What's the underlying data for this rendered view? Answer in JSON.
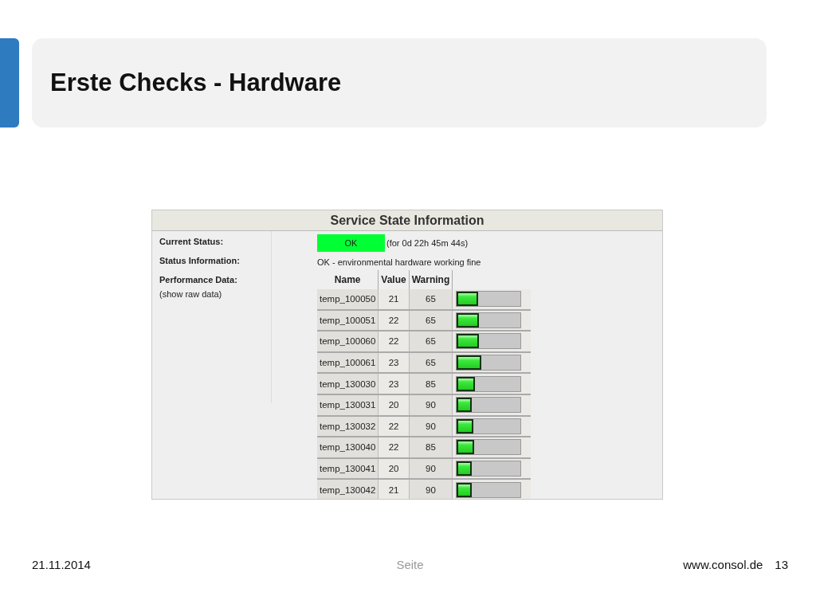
{
  "slide": {
    "title": "Erste Checks - Hardware"
  },
  "panel": {
    "title": "Service State Information",
    "fields": [
      {
        "kind": "status",
        "label": "Current Status:",
        "badge": "OK",
        "color": "#00ff33",
        "duration": "(for 0d 22h 45m 44s)"
      },
      {
        "kind": "text",
        "label": "Status Information:",
        "value": "OK - environmental hardware working fine"
      },
      {
        "kind": "table",
        "label": "Performance Data:",
        "sublabel": "(show raw data)"
      }
    ],
    "table": {
      "columns": [
        "Name",
        "Value",
        "Warning"
      ],
      "rows": [
        {
          "name": "temp_100050",
          "value": "21",
          "warning": "65",
          "level": 0.33
        },
        {
          "name": "temp_100051",
          "value": "22",
          "warning": "65",
          "level": 0.35
        },
        {
          "name": "temp_100060",
          "value": "22",
          "warning": "65",
          "level": 0.35
        },
        {
          "name": "temp_100061",
          "value": "23",
          "warning": "65",
          "level": 0.39
        },
        {
          "name": "temp_130030",
          "value": "23",
          "warning": "85",
          "level": 0.29
        },
        {
          "name": "temp_130031",
          "value": "20",
          "warning": "90",
          "level": 0.24
        },
        {
          "name": "temp_130032",
          "value": "22",
          "warning": "90",
          "level": 0.26
        },
        {
          "name": "temp_130040",
          "value": "22",
          "warning": "85",
          "level": 0.27
        },
        {
          "name": "temp_130041",
          "value": "20",
          "warning": "90",
          "level": 0.24
        },
        {
          "name": "temp_130042",
          "value": "21",
          "warning": "90",
          "level": 0.24
        }
      ]
    }
  },
  "footer": {
    "date": "21.11.2014",
    "center": "Seite",
    "url": "www.consol.de",
    "page": "13"
  }
}
